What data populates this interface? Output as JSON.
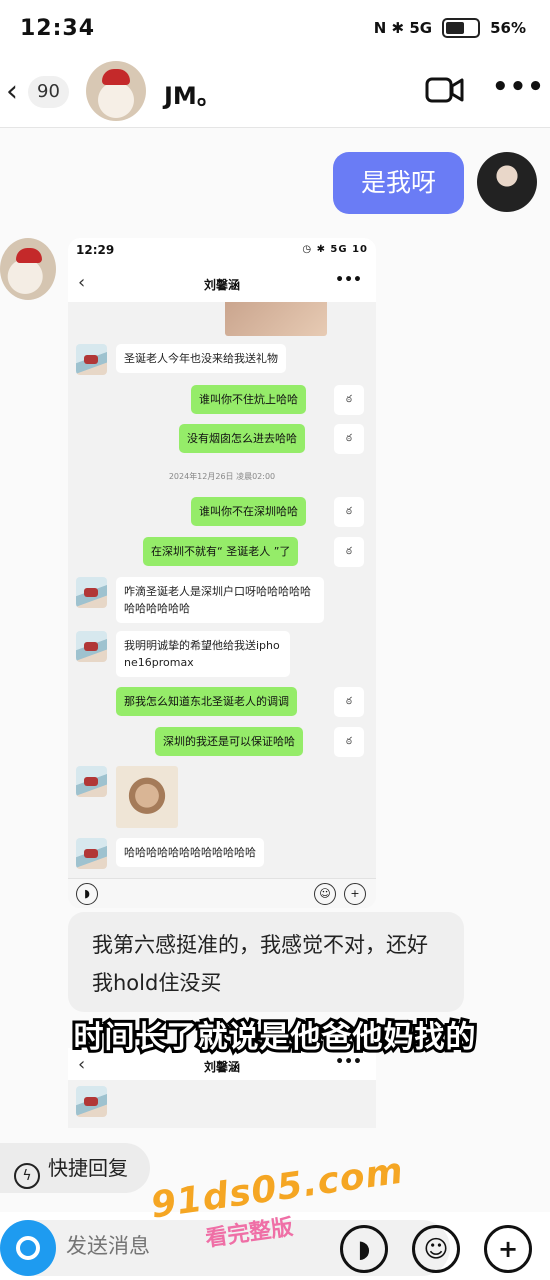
{
  "status": {
    "time": "12:34",
    "icons": "N ✱ 5G",
    "battery": "56%"
  },
  "header": {
    "back": "‹",
    "unread": "90",
    "name": "JM。",
    "more": "•••"
  },
  "chat": {
    "sent_text": "是我呀"
  },
  "inner": {
    "time": "12:29",
    "status_icons": "◷ ✱ 5G 10",
    "title": "刘馨涵",
    "back": "‹",
    "more": "•••",
    "messages": [
      {
        "side": "left",
        "text": "圣诞老人今年也没来给我送礼物"
      },
      {
        "side": "right",
        "text": "谁叫你不住炕上哈哈"
      },
      {
        "side": "right",
        "text": "没有烟囱怎么进去哈哈"
      },
      {
        "side": "right",
        "text": "谁叫你不在深圳哈哈"
      },
      {
        "side": "right",
        "text": "在深圳不就有“ 圣诞老人 ”了"
      },
      {
        "side": "left",
        "text": "咋滴圣诞老人是深圳户口呀哈哈哈哈哈哈哈哈哈哈哈"
      },
      {
        "side": "left",
        "text": "我明明诚挚的希望他给我送iphone16promax"
      },
      {
        "side": "right",
        "text": "那我怎么知道东北圣诞老人的调调"
      },
      {
        "side": "right",
        "text": "深圳的我还是可以保证哈哈"
      },
      {
        "side": "left",
        "text": "哈哈哈哈哈哈哈哈哈哈哈哈"
      }
    ],
    "timestamp": "2024年12月26日 凌晨02:00",
    "read_mark": "ఠ"
  },
  "comment": {
    "text": "我第六感挺准的，我感觉不对，还好我hold住没买"
  },
  "subtitle": "时间长了就说是他爸他妈找的",
  "inner2": {
    "title": "刘馨涵",
    "back": "‹",
    "more": "•••"
  },
  "quick_reply": {
    "label": "快捷回复",
    "icon": "ϟ"
  },
  "watermark": {
    "site": "91ds05.com",
    "tag": "看完整版"
  },
  "bottom": {
    "placeholder": "发送消息",
    "voice": "◗",
    "emoji": "☺",
    "plus": "+"
  }
}
